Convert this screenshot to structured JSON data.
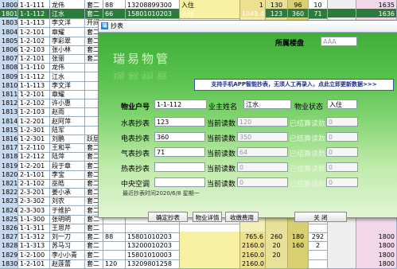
{
  "rows": [
    {
      "no": "1800",
      "acct": "1-1-111",
      "name": "龙伟",
      "type": "套二",
      "n": "88",
      "phone": "13208899300",
      "status": "入住",
      "r1": "1",
      "r2": "130",
      "r3": "96",
      "r4": "10",
      "r5": "1635"
    },
    {
      "no": "1801",
      "acct": "1-1-112",
      "name": "江水",
      "type": "套二",
      "n": "66",
      "phone": "15801010203",
      "status": "入住",
      "r1": "1049.4",
      "r2": "123",
      "r3": "360",
      "r4": "71",
      "r5": "1636",
      "sel": true
    },
    {
      "no": "1803",
      "acct": "1-1-113",
      "name": "李文洋",
      "type": "开间",
      "n": "",
      "phone": "",
      "status": "",
      "r1": "",
      "r2": "",
      "r3": "",
      "r4": "",
      "r5": ""
    },
    {
      "no": "1804",
      "acct": "1-2-101",
      "name": "章耀",
      "type": "套二",
      "n": "",
      "phone": "",
      "status": "",
      "r1": "",
      "r2": "",
      "r3": "",
      "r4": "",
      "r5": ""
    },
    {
      "no": "1805",
      "acct": "1-2-102",
      "name": "李彩翠",
      "type": "套二",
      "n": "",
      "phone": "",
      "status": "",
      "r1": "",
      "r2": "",
      "r3": "",
      "r4": "",
      "r5": ""
    },
    {
      "no": "1806",
      "acct": "1-2-103",
      "name": "张小林",
      "type": "套二",
      "n": "",
      "phone": "",
      "status": "",
      "r1": "",
      "r2": "",
      "r3": "",
      "r4": "",
      "r5": ""
    },
    {
      "no": "1807",
      "acct": "1-2-101",
      "name": "张丽",
      "type": "套二",
      "n": "",
      "phone": "",
      "status": "",
      "r1": "",
      "r2": "",
      "r3": "",
      "r4": "",
      "r5": ""
    },
    {
      "no": "1808",
      "acct": "1-1-110",
      "name": "龙伟",
      "type": "",
      "n": "",
      "phone": "",
      "status": "",
      "r1": "",
      "r2": "",
      "r3": "",
      "r4": "",
      "r5": ""
    },
    {
      "no": "1809",
      "acct": "1-1-112",
      "name": "江水",
      "type": "",
      "n": "",
      "phone": "",
      "status": "",
      "r1": "",
      "r2": "",
      "r3": "",
      "r4": "",
      "r5": ""
    },
    {
      "no": "1810",
      "acct": "1-1-113",
      "name": "李文洋",
      "type": "",
      "n": "",
      "phone": "",
      "status": "",
      "r1": "",
      "r2": "",
      "r3": "",
      "r4": "",
      "r5": ""
    },
    {
      "no": "1811",
      "acct": "1-2-101",
      "name": "章耀",
      "type": "",
      "n": "",
      "phone": "",
      "status": "",
      "r1": "",
      "r2": "",
      "r3": "",
      "r4": "",
      "r5": ""
    },
    {
      "no": "1812",
      "acct": "1-2-102",
      "name": "许小惠",
      "type": "",
      "n": "",
      "phone": "",
      "status": "",
      "r1": "",
      "r2": "",
      "r3": "",
      "r4": "",
      "r5": ""
    },
    {
      "no": "1813",
      "acct": "1-2-103",
      "name": "赵雨",
      "type": "",
      "n": "",
      "phone": "",
      "status": "",
      "r1": "",
      "r2": "",
      "r3": "",
      "r4": "",
      "r5": ""
    },
    {
      "no": "1814",
      "acct": "1-2-201",
      "name": "赵阿萍",
      "type": "",
      "n": "",
      "phone": "",
      "status": "",
      "r1": "",
      "r2": "",
      "r3": "",
      "r4": "",
      "r5": ""
    },
    {
      "no": "1815",
      "acct": "1-2-301",
      "name": "陆军",
      "type": "",
      "n": "",
      "phone": "",
      "status": "",
      "r1": "",
      "r2": "",
      "r3": "",
      "r4": "",
      "r5": ""
    },
    {
      "no": "1816",
      "acct": "1-2-301",
      "name": "刘鹏",
      "type": "跃层",
      "n": "",
      "phone": "",
      "status": "",
      "r1": "",
      "r2": "",
      "r3": "",
      "r4": "",
      "r5": ""
    },
    {
      "no": "1817",
      "acct": "1-2-110",
      "name": "王和平",
      "type": "套二",
      "n": "",
      "phone": "",
      "status": "",
      "r1": "",
      "r2": "",
      "r3": "",
      "r4": "",
      "r5": ""
    },
    {
      "no": "1818",
      "acct": "1-2-112",
      "name": "陆萍",
      "type": "套二",
      "n": "",
      "phone": "",
      "status": "",
      "r1": "",
      "r2": "",
      "r3": "",
      "r4": "",
      "r5": ""
    },
    {
      "no": "1819",
      "acct": "1-2-201",
      "name": "段于章",
      "type": "套二",
      "n": "",
      "phone": "",
      "status": "",
      "r1": "",
      "r2": "",
      "r3": "",
      "r4": "",
      "r5": ""
    },
    {
      "no": "1820",
      "acct": "2-1-101",
      "name": "李宝",
      "type": "套二",
      "n": "",
      "phone": "",
      "status": "",
      "r1": "",
      "r2": "",
      "r3": "",
      "r4": "",
      "r5": ""
    },
    {
      "no": "1821",
      "acct": "2-1-102",
      "name": "巫皓",
      "type": "套二",
      "n": "",
      "phone": "",
      "status": "",
      "r1": "",
      "r2": "",
      "r3": "",
      "r4": "",
      "r5": ""
    },
    {
      "no": "1822",
      "acct": "2-3-201",
      "name": "姜小承",
      "type": "套二",
      "n": "",
      "phone": "",
      "status": "",
      "r1": "",
      "r2": "",
      "r3": "",
      "r4": "",
      "r5": ""
    },
    {
      "no": "1823",
      "acct": "2-3-302",
      "name": "刘农",
      "type": "套二",
      "n": "",
      "phone": "",
      "status": "",
      "r1": "",
      "r2": "",
      "r3": "",
      "r4": "",
      "r5": ""
    },
    {
      "no": "1824",
      "acct": "2-3-303",
      "name": "于维护",
      "type": "套二",
      "n": "",
      "phone": "",
      "status": "",
      "r1": "",
      "r2": "",
      "r3": "",
      "r4": "",
      "r5": ""
    },
    {
      "no": "1825",
      "acct": "1-1-300",
      "name": "张明明",
      "type": "套二",
      "n": "",
      "phone": "",
      "status": "",
      "r1": "",
      "r2": "",
      "r3": "",
      "r4": "",
      "r5": ""
    },
    {
      "no": "1826",
      "acct": "1-1-311",
      "name": "王思芹",
      "type": "套二",
      "n": "",
      "phone": "",
      "status": "",
      "r1": "",
      "r2": "",
      "r3": "",
      "r4": "",
      "r5": ""
    },
    {
      "no": "1827",
      "acct": "1-1-312",
      "name": "刘一刀",
      "type": "套二",
      "n": "88",
      "phone": "15801010203",
      "status": "",
      "r1": "765.6",
      "r2": "260",
      "r3": "180",
      "r4": "292",
      "r5": "1800"
    },
    {
      "no": "1828",
      "acct": "1-1-313",
      "name": "苏马习",
      "type": "套二",
      "n": "",
      "phone": "13200010203",
      "status": "",
      "r1": "2160.0",
      "r2": "20",
      "r3": "160",
      "r4": "2",
      "r5": "1800"
    },
    {
      "no": "1829",
      "acct": "1-2-100",
      "name": "李小小青",
      "type": "套二",
      "n": "",
      "phone": "15801010003",
      "status": "",
      "r1": "2160.0",
      "r2": "20",
      "r3": "",
      "r4": "",
      "r5": "1800"
    },
    {
      "no": "1830",
      "acct": "1-2-101",
      "name": "赵莲蕾",
      "type": "套二",
      "n": "120",
      "phone": "13209801258",
      "status": "",
      "r1": "2160.0",
      "r2": "",
      "r3": "",
      "r4": "",
      "r5": "1800"
    }
  ],
  "dialog": {
    "title": "抄表",
    "brand": "瑞易物管",
    "building_label": "所属楼盘",
    "building_value": "AAA",
    "banner": "支持手机APP智能抄表，无须人工再录入，点此立即更新数据>>>",
    "account_label": "物业户号",
    "account_value": "1-1-112",
    "owner_label": "业主姓名",
    "owner_value": "江水",
    "status_label": "物业状态",
    "status_value": "入住",
    "meters": [
      {
        "label": "水表抄表",
        "value": "123",
        "current_label": "当前读数",
        "current": "120",
        "settled_label": "已结算读数",
        "settled": "0"
      },
      {
        "label": "电表抄表",
        "value": "360",
        "current_label": "当前读数",
        "current": "350",
        "settled_label": "已结算读数",
        "settled": "0"
      },
      {
        "label": "气表抄表",
        "value": "71",
        "current_label": "当前读数",
        "current": "64",
        "settled_label": "已结算读数",
        "settled": "0"
      },
      {
        "label": "热表抄表",
        "value": "",
        "current_label": "当前读数",
        "current": "0",
        "settled_label": "已结算读数",
        "settled": "0"
      },
      {
        "label": "中央空调",
        "value": "",
        "current_label": "当前读数",
        "current": "0",
        "settled_label": "已结算读数",
        "settled": "0"
      }
    ],
    "last_read": "最近抄表时间2020/6/8  星期一",
    "buttons": {
      "confirm": "确定抄表",
      "detail": "物业详情",
      "fees": "收缴费用",
      "close": "关  闭"
    }
  }
}
